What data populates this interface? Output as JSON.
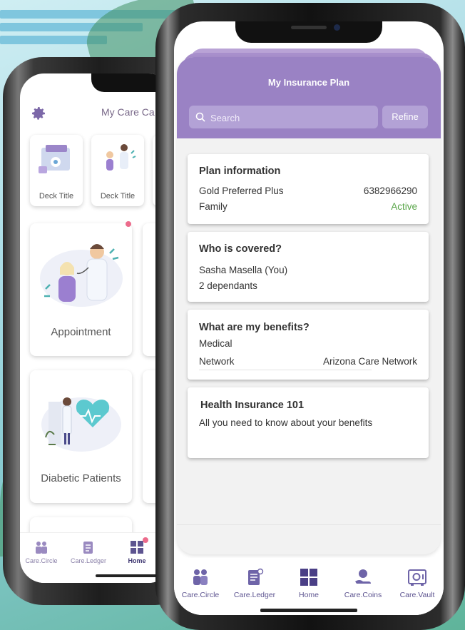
{
  "back_screen": {
    "title": "My Care Ca",
    "deck_cards": [
      {
        "label": "Deck Title"
      },
      {
        "label": "Deck Title"
      }
    ],
    "tiles": [
      {
        "label": "Appointment"
      },
      {
        "label": "Diabetic Patients"
      }
    ],
    "tabs": [
      {
        "label": "Care.Circle",
        "icon": "people-icon"
      },
      {
        "label": "Care.Ledger",
        "icon": "ledger-icon"
      },
      {
        "label": "Home",
        "icon": "home-grid-icon",
        "active": true
      }
    ]
  },
  "modal": {
    "title": "My Insurance Plan",
    "search_placeholder": "Search",
    "refine_label": "Refine"
  },
  "cards": {
    "plan": {
      "title": "Plan information",
      "plan_name": "Gold Preferred Plus",
      "plan_number": "6382966290",
      "coverage_type": "Family",
      "status": "Active"
    },
    "covered": {
      "title": "Who is covered?",
      "member": "Sasha Masella (You)",
      "dependants": "2 dependants"
    },
    "benefits": {
      "title": "What are my benefits?",
      "category": "Medical",
      "network_label": "Network",
      "network_value": "Arizona Care Network"
    },
    "insurance101": {
      "title": "Health Insurance 101",
      "description": "All you need to know about your benefits"
    }
  },
  "tabbar": [
    {
      "label": "Care.Circle",
      "icon": "people-icon"
    },
    {
      "label": "Care.Ledger",
      "icon": "ledger-icon"
    },
    {
      "label": "Home",
      "icon": "home-grid-icon"
    },
    {
      "label": "Care.Coins",
      "icon": "coin-hand-icon"
    },
    {
      "label": "Care.Vault",
      "icon": "vault-icon"
    }
  ],
  "colors": {
    "header_purple": "#9a82c4",
    "search_bg": "#b3a2d6",
    "active_green": "#5aa64a",
    "tab_icon": "#5d5490"
  }
}
